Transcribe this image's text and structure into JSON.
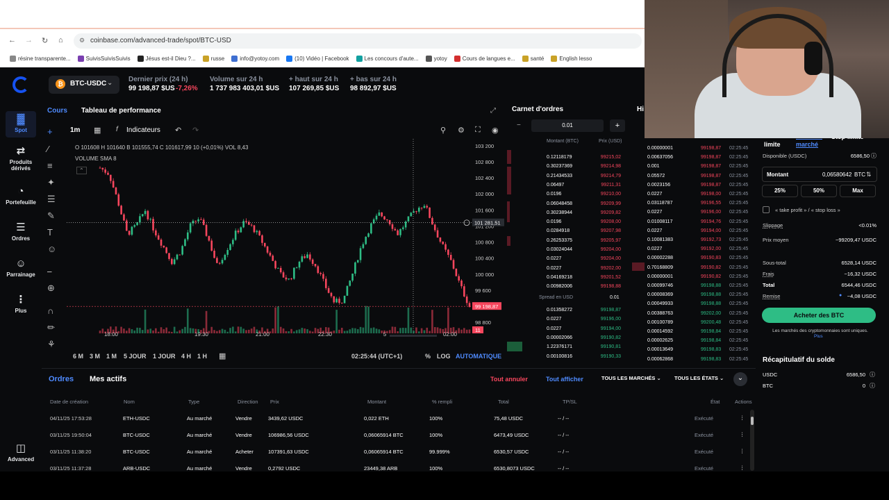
{
  "browser": {
    "url": "coinbase.com/advanced-trade/spot/BTC-USD",
    "bookmarks": [
      "résine transparente...",
      "SuivisSuivisSuivis",
      "Jésus est-il Dieu ?...",
      "russe",
      "info@yotoy.com",
      "(10) Vidéo | Facebook",
      "Les concours d'aute...",
      "yotoy",
      "Cours de langues e...",
      "santé",
      "English lesso"
    ]
  },
  "sidebar": {
    "items": [
      {
        "label": "Spot",
        "icon": "chart-bars-icon"
      },
      {
        "label": "Produits dérivés",
        "icon": "arrows-icon"
      },
      {
        "label": "Portefeuille",
        "icon": "pie-icon"
      },
      {
        "label": "Ordres",
        "icon": "list-icon"
      },
      {
        "label": "Parrainage",
        "icon": "add-user-icon"
      },
      {
        "label": "Plus",
        "icon": "more-icon"
      }
    ],
    "advanced_label": "Advanced"
  },
  "market": {
    "pair": "BTC-USDC",
    "last_price_label": "Dernier prix (24 h)",
    "last_price": "99 198,87 $US",
    "change": "-7,26%",
    "volume_label": "Volume sur 24 h",
    "volume": "1 737 983 403,01 $US",
    "high_label": "+ haut sur 24 h",
    "high": "107 269,85 $US",
    "low_label": "+ bas sur 24 h",
    "low": "98 892,97 $US"
  },
  "chart_panel": {
    "tabs": [
      "Cours",
      "Tableau de performance"
    ],
    "interval": "1m",
    "indicators_label": "Indicateurs",
    "ohlc": "O 101608  H 101640  B 101555,74  C 101617,99  10 (+0,01%)  VOL 8,43",
    "volume_sma": "VOLUME SMA  8",
    "crosshair_price": "101 281,51",
    "current_price_tag": "99 198,87",
    "volume_tag": "11",
    "crosshair_time": "05 Nov '25   00:51",
    "ranges": [
      "6 M",
      "3 M",
      "1 M",
      "5 JOUR",
      "1 JOUR",
      "4 H",
      "1 H"
    ],
    "clock": "02:25:44 (UTC+1)",
    "pct_label": "%",
    "log_label": "LOG",
    "auto_label": "AUTOMATIQUE"
  },
  "chart_data": {
    "type": "candlestick",
    "y_ticks": [
      "103 200",
      "102 800",
      "102 400",
      "102 000",
      "101 600",
      "101 200",
      "100 800",
      "100 400",
      "100 000",
      "99 600",
      "99 200",
      "98 800"
    ],
    "x_ticks": [
      "18:00",
      "19:30",
      "21:00",
      "22:30",
      "5",
      "02:00"
    ],
    "close_path": [
      102650,
      102500,
      101800,
      101000,
      101200,
      101600,
      101100,
      100700,
      100300,
      100600,
      101200,
      101400,
      100900,
      100200,
      100600,
      101000,
      101300,
      101150,
      100800,
      100400,
      100000,
      99850,
      100300,
      100500,
      100200,
      99700,
      99300,
      99350,
      100000,
      100700,
      101200,
      101500,
      101350,
      101000,
      101300,
      101600,
      101750,
      101200,
      100700,
      100300,
      99700,
      99198.87
    ],
    "ylim": [
      98700,
      103300
    ]
  },
  "orderbook": {
    "title": "Carnet d'ordres",
    "size": "0.01",
    "col_amount": "Montant (BTC)",
    "col_price": "Prix (USD)",
    "asks": [
      {
        "amount": "0.12118179",
        "price": "99215,02"
      },
      {
        "amount": "0.30237369",
        "price": "99214,98"
      },
      {
        "amount": "0.21434533",
        "price": "99214,79"
      },
      {
        "amount": "0.06497",
        "price": "99211,31"
      },
      {
        "amount": "0.0196",
        "price": "99210,00"
      },
      {
        "amount": "0.06048458",
        "price": "99209,99"
      },
      {
        "amount": "0.30238944",
        "price": "99209,82"
      },
      {
        "amount": "0.0196",
        "price": "99208,00"
      },
      {
        "amount": "0.0284918",
        "price": "99207,98"
      },
      {
        "amount": "0.26253375",
        "price": "99205,97"
      },
      {
        "amount": "0.03024044",
        "price": "99204,00"
      },
      {
        "amount": "0.0227",
        "price": "99204,00"
      },
      {
        "amount": "0.0227",
        "price": "99202,00"
      },
      {
        "amount": "0.04169218",
        "price": "99201,52"
      },
      {
        "amount": "0.00982006",
        "price": "99198,88"
      }
    ],
    "spread_label": "Spread en USD",
    "spread": "0.01",
    "bids": [
      {
        "amount": "0.01358272",
        "price": "99198,87"
      },
      {
        "amount": "0.0227",
        "price": "99196,00"
      },
      {
        "amount": "0.0227",
        "price": "99194,00"
      },
      {
        "amount": "0.00002066",
        "price": "99190,82"
      },
      {
        "amount": "1.22376171",
        "price": "99190,81"
      },
      {
        "amount": "0.00100816",
        "price": "99190,33"
      }
    ]
  },
  "trades": [
    {
      "a": "0.00000001",
      "p": "99198,87",
      "t": "02:25:45",
      "c": "red"
    },
    {
      "a": "0.00637056",
      "p": "99198,87",
      "t": "02:25:45",
      "c": "red"
    },
    {
      "a": "0.001",
      "p": "99198,87",
      "t": "02:25:45",
      "c": "red"
    },
    {
      "a": "0.05572",
      "p": "99198,87",
      "t": "02:25:45",
      "c": "red"
    },
    {
      "a": "0.0023156",
      "p": "99198,87",
      "t": "02:25:45",
      "c": "red"
    },
    {
      "a": "0.0227",
      "p": "99198,00",
      "t": "02:25:45",
      "c": "red"
    },
    {
      "a": "0.03118787",
      "p": "99196,55",
      "t": "02:25:45",
      "c": "red"
    },
    {
      "a": "0.0227",
      "p": "99196,00",
      "t": "02:25:45",
      "c": "red"
    },
    {
      "a": "0.01008117",
      "p": "99194,76",
      "t": "02:25:45",
      "c": "red"
    },
    {
      "a": "0.0227",
      "p": "99194,00",
      "t": "02:25:45",
      "c": "red"
    },
    {
      "a": "0.10081383",
      "p": "99192,73",
      "t": "02:25:45",
      "c": "red"
    },
    {
      "a": "0.0227",
      "p": "99192,00",
      "t": "02:25:45",
      "c": "red"
    },
    {
      "a": "0.00002288",
      "p": "99190,83",
      "t": "02:25:45",
      "c": "red"
    },
    {
      "a": "0.70168809",
      "p": "99190,82",
      "t": "02:25:45",
      "c": "red"
    },
    {
      "a": "0.00000001",
      "p": "99190,82",
      "t": "02:25:45",
      "c": "red"
    },
    {
      "a": "0.00099746",
      "p": "99198,88",
      "t": "02:25:45",
      "c": "green"
    },
    {
      "a": "0.00008369",
      "p": "99198,88",
      "t": "02:25:45",
      "c": "green"
    },
    {
      "a": "0.00049933",
      "p": "99198,88",
      "t": "02:25:45",
      "c": "green"
    },
    {
      "a": "0.00388763",
      "p": "99202,00",
      "t": "02:25:45",
      "c": "green"
    },
    {
      "a": "0.00100789",
      "p": "99200,48",
      "t": "02:25:45",
      "c": "green"
    },
    {
      "a": "0.00014592",
      "p": "99198,84",
      "t": "02:25:45",
      "c": "green"
    },
    {
      "a": "0.00002625",
      "p": "99198,84",
      "t": "02:25:45",
      "c": "green"
    },
    {
      "a": "0.00013649",
      "p": "99198,83",
      "t": "02:25:45",
      "c": "green"
    },
    {
      "a": "0.00062868",
      "p": "99198,83",
      "t": "02:25:45",
      "c": "green"
    }
  ],
  "trade_panel": {
    "tab_limit": "Ordre limite",
    "tab_market": "Ordre du marché",
    "tab_stop": "Stop-limite",
    "available_label": "Disponible (USDC)",
    "available": "6586,50",
    "amount_label": "Montant",
    "amount_value": "0,06580642",
    "amount_unit": "BTC",
    "pct": [
      "25%",
      "50%",
      "Max"
    ],
    "tpsl_label": "« take profit » / « stop loss »",
    "slippage_label": "Slippage",
    "slippage": "<0.01%",
    "avg_price_label": "Prix moyen",
    "avg_price": "~99209,47 USDC",
    "subtotal_label": "Sous-total",
    "subtotal": "6528,14 USDC",
    "fees_label": "Frais",
    "fees": "~16,32 USDC",
    "total_label": "Total",
    "total": "6544,46 USDC",
    "rebate_label": "Remise",
    "rebate": "~4,08 USDC",
    "buy_label": "Acheter des BTC",
    "note": "Les marchés des cryptomonnaies sont uniques.",
    "note_link": "Plus",
    "balance_title": "Récapitulatif du solde",
    "balances": [
      {
        "asset": "USDC",
        "value": "6586,50"
      },
      {
        "asset": "BTC",
        "value": "0"
      }
    ]
  },
  "orders": {
    "tabs": [
      "Ordres",
      "Mes actifs"
    ],
    "cancel_all": "Tout annuler",
    "show_all": "Tout afficher",
    "markets_filter": "TOUS LES MARCHÉS",
    "states_filter": "TOUS LES ÉTATS",
    "headers": [
      "Date de création",
      "Nom",
      "Type",
      "Direction",
      "Prix",
      "Montant",
      "% rempli",
      "Total",
      "TP/SL",
      "État",
      "Actions"
    ],
    "rows": [
      [
        "04/11/25 17:53:28",
        "ETH-USDC",
        "Au marché",
        "Vendre",
        "3439,62 USDC",
        "0,022 ETH",
        "100%",
        "75,48 USDC",
        "-- / --",
        "Exécuté"
      ],
      [
        "03/11/25 19:50:04",
        "BTC-USDC",
        "Au marché",
        "Vendre",
        "106986,56 USDC",
        "0,06065914 BTC",
        "100%",
        "6473,49 USDC",
        "-- / --",
        "Exécuté"
      ],
      [
        "03/11/25 11:38:20",
        "BTC-USDC",
        "Au marché",
        "Acheter",
        "107391,63 USDC",
        "0,06065914 BTC",
        "99.999%",
        "6530,57 USDC",
        "-- / --",
        "Exécuté"
      ],
      [
        "03/11/25 11:37:28",
        "ARB-USDC",
        "Au marché",
        "Vendre",
        "0,2792 USDC",
        "23449,38 ARB",
        "100%",
        "6530,8073 USDC",
        "-- / --",
        "Exécuté"
      ]
    ]
  },
  "colors": {
    "accent": "#1652f0",
    "up": "#2ebd85",
    "down": "#f6465d",
    "bg": "#0a0b0d"
  }
}
